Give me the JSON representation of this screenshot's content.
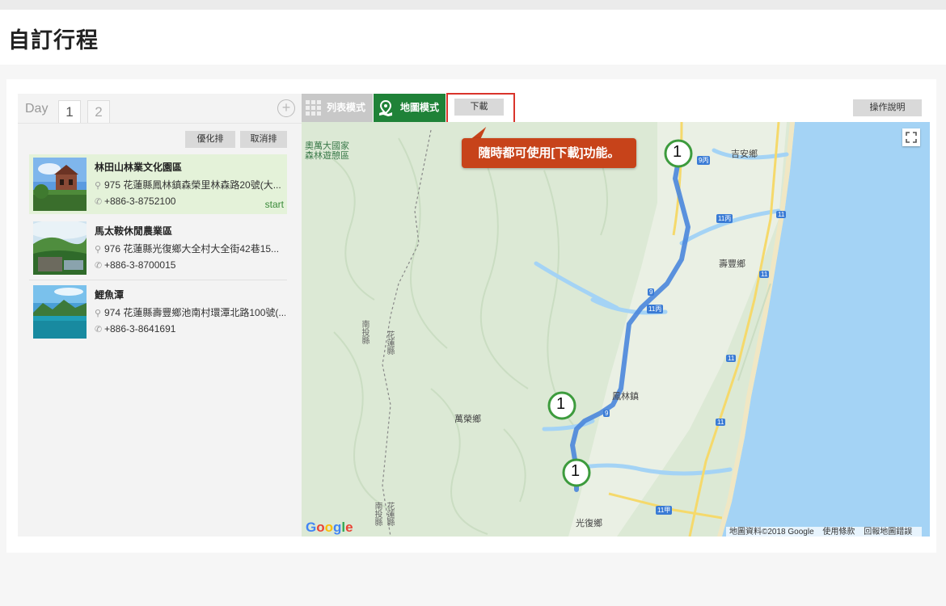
{
  "page": {
    "title": "自訂行程"
  },
  "day_bar": {
    "label": "Day",
    "tabs": [
      "1",
      "2"
    ],
    "add_symbol": "+"
  },
  "list_controls": {
    "optimize": "優化排",
    "cancel": "取消排"
  },
  "places": [
    {
      "name": "林田山林業文化園區",
      "address": "975 花蓮縣鳳林鎮森榮里林森路20號(大...",
      "phone": "+886-3-8752100",
      "tag": "start"
    },
    {
      "name": "馬太鞍休閒農業區",
      "address": "976 花蓮縣光復鄉大全村大全街42巷15...",
      "phone": "+886-3-8700015",
      "tag": ""
    },
    {
      "name": "鯉魚潭",
      "address": "974 花蓮縣壽豐鄉池南村環潭北路100號(...",
      "phone": "+886-3-8641691",
      "tag": ""
    }
  ],
  "toolbar": {
    "list_mode": "列表模式",
    "map_mode": "地圖模式",
    "download": "下載",
    "help": "操作說明"
  },
  "tooltip": {
    "text": "隨時都可使用[下載]功能。"
  },
  "map": {
    "labels": {
      "forest": "奧萬大國家\n森林遊憩區",
      "jian": "吉安鄉",
      "shoufeng": "壽豐鄉",
      "fenglin": "鳳林鎮",
      "wanrong": "萬榮鄉",
      "guangfu": "光復鄉",
      "nantou1": "南投縣",
      "hualien1": "花蓮縣",
      "nantou2": "南投縣",
      "hualien2": "花蓮縣"
    },
    "road_badges": {
      "r9c": "9丙",
      "r11c": "11丙",
      "r11": "11",
      "r9": "9",
      "r11d": "11甲"
    },
    "markers": [
      "1",
      "1",
      "1"
    ],
    "footer": {
      "data": "地圖資料©2018 Google",
      "terms": "使用條款",
      "report": "回報地圖錯誤"
    },
    "logo": [
      "G",
      "o",
      "o",
      "g",
      "l",
      "e"
    ],
    "colors": {
      "sea": "#a4d3f5",
      "land": "#dce9d5",
      "route": "#4a86db",
      "marker_ring": "#3d9b3d"
    }
  }
}
